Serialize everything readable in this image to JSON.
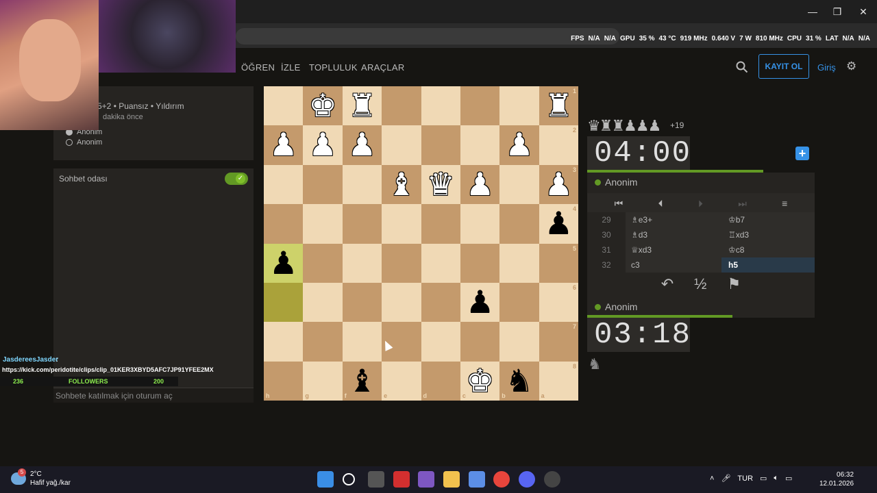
{
  "window": {
    "minimize": "—",
    "maximize": "❐",
    "close": "✕"
  },
  "overlay_stats": {
    "fps_label": "FPS",
    "fps_value": "N/A",
    "fps_value2": "N/A",
    "gpu_label": "GPU",
    "gpu_usage": "35 %",
    "gpu_temp": "43 °C",
    "gpu_clock": "919 MHz",
    "gpu_volt": "0.640 V",
    "gpu_power": "7 W",
    "mem_clock": "810 MHz",
    "cpu_label": "CPU",
    "cpu_usage": "31 %",
    "lat_label": "LAT",
    "lat_value": "N/A",
    "lat_value2": "N/A"
  },
  "nav": {
    "learn": "ÖĞREN",
    "watch": "İZLE",
    "community": "TOPLULUK",
    "tools": "ARAÇLAR",
    "signup": "KAYIT OL",
    "login": "Giriş"
  },
  "game_info": {
    "meta": "5+2 • Puansız • Yıldırım",
    "time_ago": "dakika önce",
    "white_player": "Anonim",
    "black_player": "Anonim"
  },
  "chat": {
    "title": "Sohbet odası",
    "input_placeholder": "Sohbete katılmak için oturum aç"
  },
  "stream_overlay": {
    "user": "JasdereesJasder",
    "colon": ":",
    "link": "https://kick.com/peridotite/clips/clip_01KER3XBYD5AFC7JP91YFEE2MX",
    "count_left": "236",
    "followers_label": "FOLLOWERS",
    "count_right": "200"
  },
  "board": {
    "files_bottom": [
      "h",
      "g",
      "f",
      "e",
      "d",
      "c",
      "b",
      "a"
    ],
    "ranks_right": [
      "1",
      "2",
      "3",
      "4",
      "5",
      "6",
      "7",
      "8"
    ],
    "highlight": [
      [
        4,
        0
      ],
      [
        5,
        0
      ]
    ],
    "pieces": [
      {
        "row": 0,
        "col": 1,
        "symbol": "♚",
        "color": "w"
      },
      {
        "row": 0,
        "col": 2,
        "symbol": "♜",
        "color": "w"
      },
      {
        "row": 0,
        "col": 7,
        "symbol": "♜",
        "color": "w"
      },
      {
        "row": 1,
        "col": 0,
        "symbol": "♟",
        "color": "w"
      },
      {
        "row": 1,
        "col": 1,
        "symbol": "♟",
        "color": "w"
      },
      {
        "row": 1,
        "col": 2,
        "symbol": "♟",
        "color": "w"
      },
      {
        "row": 1,
        "col": 6,
        "symbol": "♟",
        "color": "w"
      },
      {
        "row": 2,
        "col": 3,
        "symbol": "♝",
        "color": "w"
      },
      {
        "row": 2,
        "col": 4,
        "symbol": "♛",
        "color": "w"
      },
      {
        "row": 2,
        "col": 5,
        "symbol": "♟",
        "color": "w"
      },
      {
        "row": 2,
        "col": 7,
        "symbol": "♟",
        "color": "w"
      },
      {
        "row": 3,
        "col": 7,
        "symbol": "♟",
        "color": "b"
      },
      {
        "row": 4,
        "col": 0,
        "symbol": "♟",
        "color": "b"
      },
      {
        "row": 5,
        "col": 5,
        "symbol": "♟",
        "color": "b"
      },
      {
        "row": 7,
        "col": 2,
        "symbol": "♝",
        "color": "b"
      },
      {
        "row": 7,
        "col": 5,
        "symbol": "♚",
        "color": "w"
      },
      {
        "row": 7,
        "col": 6,
        "symbol": "♞",
        "color": "b"
      }
    ]
  },
  "captured": {
    "pieces": "♛♜♜♟♟♟",
    "score": "+19"
  },
  "clocks": {
    "top": "04:00",
    "bottom": "03:18",
    "add_time": "+"
  },
  "players": {
    "top": "Anonim",
    "bottom": "Anonim"
  },
  "move_nav": {
    "first": "⏮",
    "prev": "⏴",
    "next": "⏵",
    "last": "⏭",
    "menu": "≡"
  },
  "moves": [
    {
      "num": "29",
      "white": "♗e3+",
      "black": "♔b7"
    },
    {
      "num": "30",
      "white": "♗d3",
      "black": "♖xd3"
    },
    {
      "num": "31",
      "white": "♕xd3",
      "black": "♔c8"
    },
    {
      "num": "32",
      "white": "c3",
      "black": "h5"
    }
  ],
  "controls": {
    "takeback": "↶",
    "draw": "½",
    "resign": "⚑"
  },
  "taskbar": {
    "temp": "2°C",
    "weather": "Hafif yağ./kar",
    "weather_badge": "5",
    "lang": "TUR",
    "time": "06:32",
    "date": "12.01.2026"
  }
}
